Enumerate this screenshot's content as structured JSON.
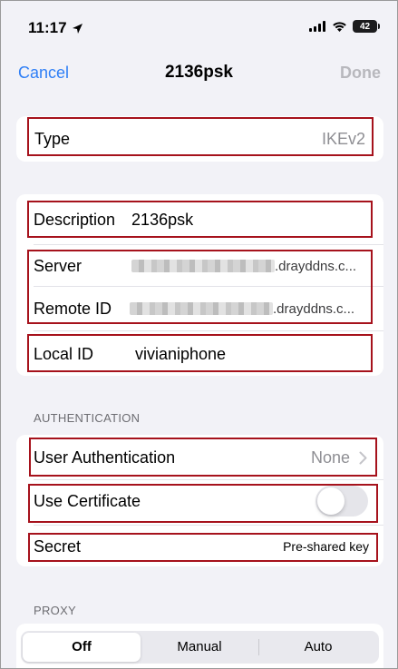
{
  "status_bar": {
    "time": "11:17",
    "battery": "42",
    "icons": [
      "location-arrow-icon",
      "cellular-signal-icon",
      "wifi-icon",
      "battery-icon"
    ]
  },
  "nav": {
    "cancel": "Cancel",
    "title": "2136psk",
    "done": "Done"
  },
  "type_row": {
    "label": "Type",
    "value": "IKEv2"
  },
  "connection": {
    "description_label": "Description",
    "description_value": "2136psk",
    "server_label": "Server",
    "server_value_suffix": ".drayddns.c...",
    "remote_id_label": "Remote ID",
    "remote_id_value_suffix": ".drayddns.c...",
    "local_id_label": "Local ID",
    "local_id_value": "vivianiphone"
  },
  "authentication": {
    "header": "AUTHENTICATION",
    "user_auth_label": "User Authentication",
    "user_auth_value": "None",
    "use_certificate_label": "Use Certificate",
    "use_certificate_on": false,
    "secret_label": "Secret",
    "secret_value": "Pre-shared key"
  },
  "proxy": {
    "header": "PROXY",
    "options": [
      "Off",
      "Manual",
      "Auto"
    ],
    "selected": "Off"
  },
  "colors": {
    "accent": "#2f7ff6",
    "highlight_box": "#a6121c",
    "background": "#f2f2f7"
  }
}
